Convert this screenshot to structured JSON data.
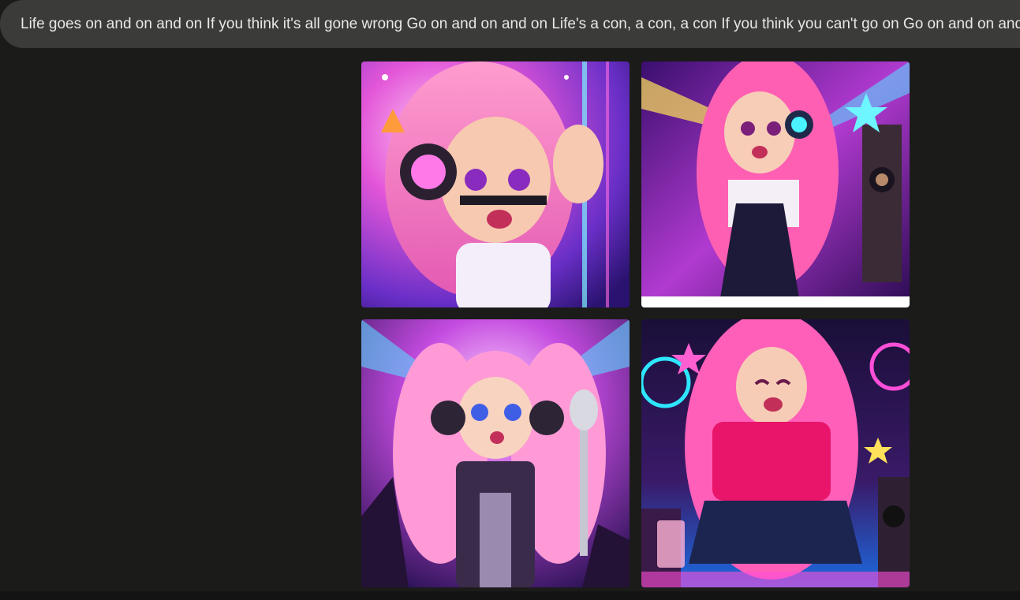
{
  "prompt": {
    "text": "Life goes on and on and on If you think it's all gone wrong Go on and on and on Life's a con, a con, a con If you think you can't go on Go on and on and on"
  },
  "images": [
    {
      "name": "image-1",
      "description_icon": "anime-girl-headphones-peace-sign"
    },
    {
      "name": "image-2",
      "description_icon": "anime-girl-dj-booth"
    },
    {
      "name": "image-3",
      "description_icon": "anime-girl-microphone"
    },
    {
      "name": "image-4",
      "description_icon": "anime-girl-dancing-neon"
    }
  ],
  "colors": {
    "background": "#1b1b1a",
    "prompt_bar": "#3b3b3a",
    "prompt_text": "#e8e8e8"
  }
}
